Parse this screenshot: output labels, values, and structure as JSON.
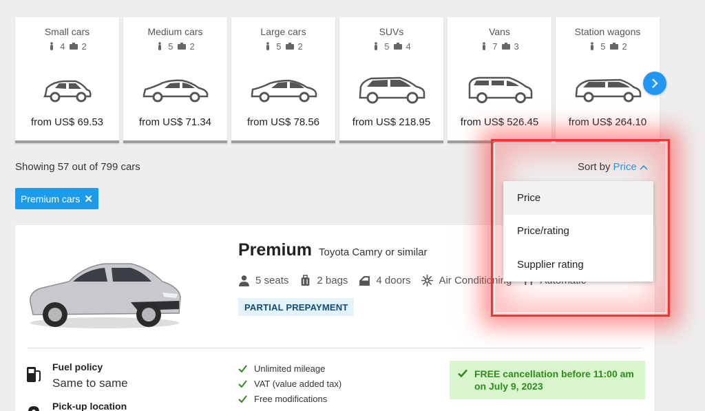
{
  "categories": [
    {
      "name": "Small cars",
      "seats": "4",
      "bags": "2",
      "price": "from US$ 69.53",
      "icon": "small-car-icon"
    },
    {
      "name": "Medium cars",
      "seats": "5",
      "bags": "2",
      "price": "from US$ 71.34",
      "icon": "medium-car-icon"
    },
    {
      "name": "Large cars",
      "seats": "5",
      "bags": "2",
      "price": "from US$ 78.56",
      "icon": "large-car-icon"
    },
    {
      "name": "SUVs",
      "seats": "5",
      "bags": "4",
      "price": "from US$ 218.95",
      "icon": "suv-icon"
    },
    {
      "name": "Vans",
      "seats": "7",
      "bags": "3",
      "price": "from US$ 526.45",
      "icon": "van-icon"
    },
    {
      "name": "Station wagons",
      "seats": "5",
      "bags": "2",
      "price": "from US$ 264.10",
      "icon": "station-wagon-icon"
    }
  ],
  "results_summary": "Showing 57 out of 799 cars",
  "active_filter": {
    "label": "Premium cars",
    "remove": "✕"
  },
  "sort": {
    "label": "Sort by",
    "value": "Price",
    "options": [
      "Price",
      "Price/rating",
      "Supplier rating"
    ]
  },
  "result": {
    "class": "Premium",
    "model": "Toyota Camry or similar",
    "features": {
      "seats": "5 seats",
      "bags": "2 bags",
      "doors": "4 doors",
      "ac": "Air Conditioning",
      "transmission": "Automatic"
    },
    "badge": "PARTIAL PREPAYMENT",
    "fuel_policy_label": "Fuel policy",
    "fuel_policy_value": "Same to same",
    "pickup_label": "Pick-up location",
    "inclusions": [
      "Unlimited mileage",
      "VAT (value added tax)",
      "Free modifications"
    ],
    "free_cancellation": "FREE cancellation before 11:00 am on July 9, 2023"
  },
  "colors": {
    "accent": "#1e9be8",
    "highlight": "#e53935",
    "success": "#2e8b1e"
  }
}
